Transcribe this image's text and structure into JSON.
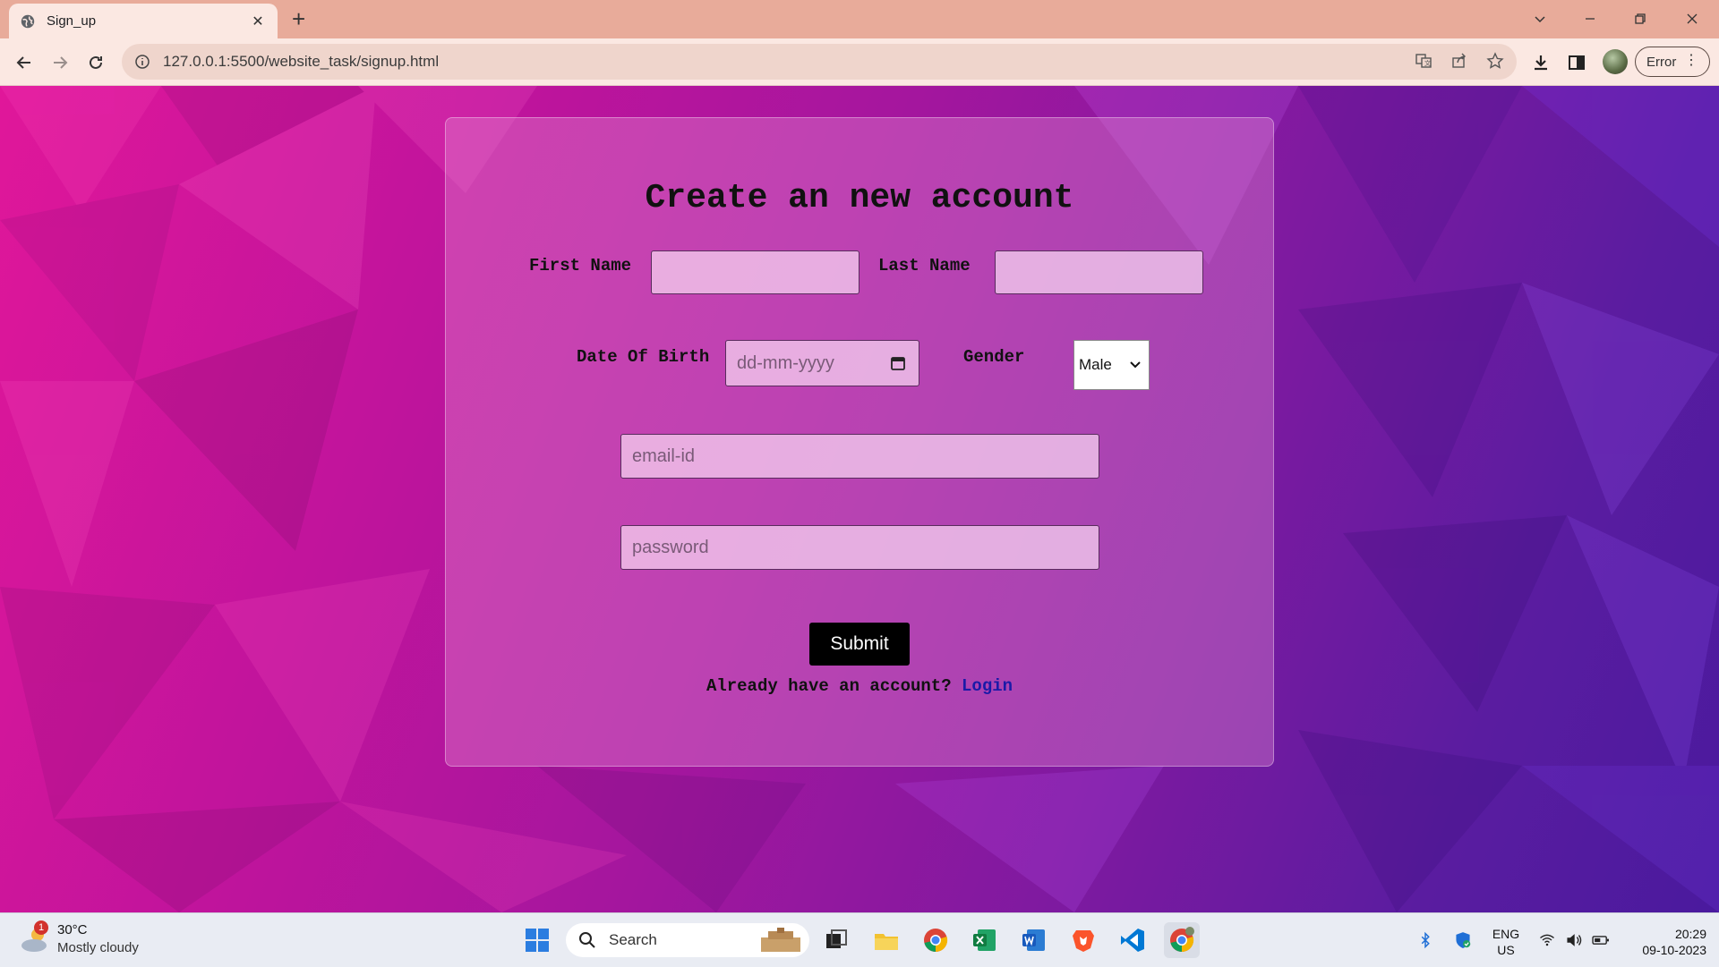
{
  "browser": {
    "tab_title": "Sign_up",
    "url": "127.0.0.1:5500/website_task/signup.html",
    "profile_status": "Error"
  },
  "form": {
    "heading": "Create an new account",
    "first_name_label": "First Name",
    "last_name_label": "Last Name",
    "dob_label": "Date Of Birth",
    "dob_placeholder": "dd-mm-yyyy",
    "gender_label": "Gender",
    "gender_value": "Male",
    "email_placeholder": "email-id",
    "password_placeholder": "password",
    "submit_label": "Submit",
    "login_prompt": "Already have an account?",
    "login_link": "Login"
  },
  "taskbar": {
    "weather_temp": "30°C",
    "weather_desc": "Mostly cloudy",
    "weather_badge": "1",
    "search_label": "Search",
    "lang": "ENG",
    "region": "US",
    "time": "20:29",
    "date": "09-10-2023"
  },
  "colors": {
    "link": "#1a1aa8",
    "submit_bg": "#000000",
    "tabbar_bg": "#e8ab9a"
  }
}
